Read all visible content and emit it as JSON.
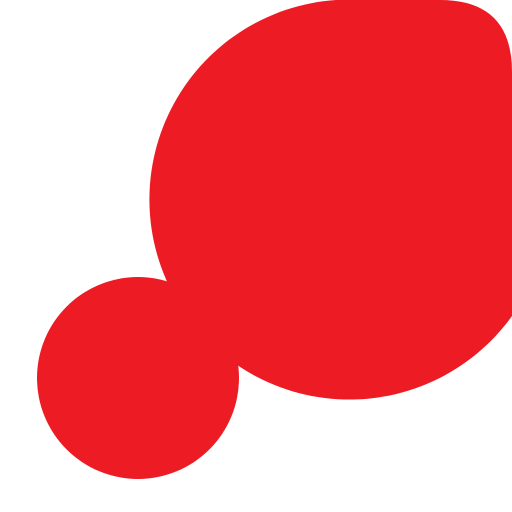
{
  "colors": {
    "background": "#ffffff",
    "shape_fill": "#ed1c24"
  },
  "icon": {
    "name": "red-circles-logo-icon"
  }
}
